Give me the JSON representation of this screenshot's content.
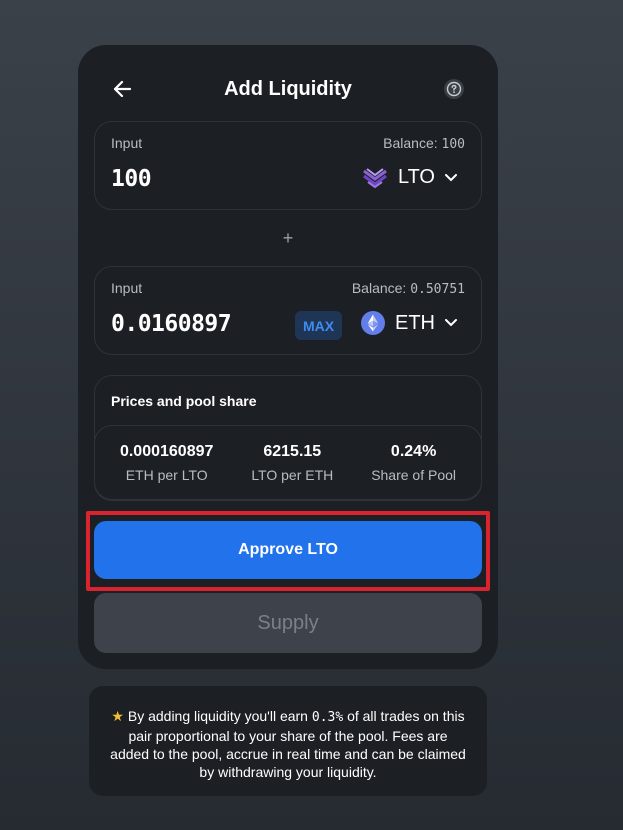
{
  "header": {
    "title": "Add Liquidity",
    "back_icon": "arrow-left-icon",
    "help_icon": "question-circle-icon"
  },
  "input_a": {
    "label": "Input",
    "balance_prefix": "Balance: ",
    "balance_value": "100",
    "amount": "100",
    "token": "LTO",
    "token_icon": "lto-logo-icon"
  },
  "plus_sign": "+",
  "input_b": {
    "label": "Input",
    "balance_prefix": "Balance: ",
    "balance_value": "0.50751",
    "amount": "0.0160897",
    "max_label": "MAX",
    "token": "ETH",
    "token_icon": "eth-logo-icon"
  },
  "prices": {
    "title": "Prices and pool share",
    "stats": [
      {
        "value": "0.000160897",
        "label": "ETH per LTO"
      },
      {
        "value": "6215.15",
        "label": "LTO per ETH"
      },
      {
        "value": "0.24%",
        "label": "Share of Pool"
      }
    ]
  },
  "actions": {
    "approve_label": "Approve LTO",
    "supply_label": "Supply"
  },
  "info": {
    "star": "★",
    "text_before": " By adding liquidity you'll earn ",
    "percent": "0.3%",
    "text_after": " of all trades on this pair proportional to your share of the pool. Fees are added to the pool, accrue in real time and can be claimed by withdrawing your liquidity."
  },
  "colors": {
    "accent": "#2272eb",
    "highlight_border": "#d9232e",
    "max_text": "#3e8cf2",
    "star": "#f3c032"
  }
}
